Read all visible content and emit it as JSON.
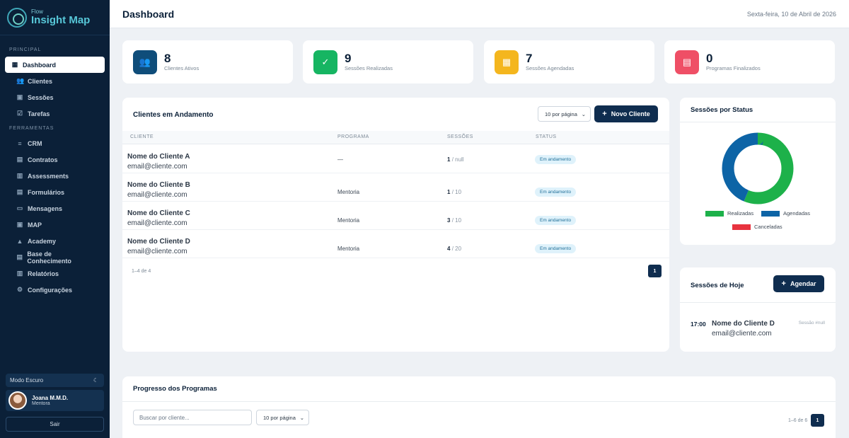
{
  "brand": {
    "small": "Flow",
    "name": "Insight Map"
  },
  "sidebar": {
    "section_principal": "PRINCIPAL",
    "section_ferramentas": "FERRAMENTAS",
    "principal": [
      {
        "label": "Dashboard",
        "icon": "grid-icon"
      },
      {
        "label": "Clientes",
        "icon": "users-icon"
      },
      {
        "label": "Sessões",
        "icon": "calendar-icon"
      },
      {
        "label": "Tarefas",
        "icon": "checkbox-icon"
      }
    ],
    "ferramentas": [
      {
        "label": "CRM",
        "icon": "list-icon"
      },
      {
        "label": "Contratos",
        "icon": "document-icon"
      },
      {
        "label": "Assessments",
        "icon": "chart-icon"
      },
      {
        "label": "Formulários",
        "icon": "form-icon"
      },
      {
        "label": "Mensagens",
        "icon": "message-icon"
      },
      {
        "label": "MAP",
        "icon": "map-icon"
      },
      {
        "label": "Academy",
        "icon": "graduation-icon"
      },
      {
        "label": "Base de Conhecimento",
        "icon": "book-icon"
      },
      {
        "label": "Relatórios",
        "icon": "report-icon"
      },
      {
        "label": "Configurações",
        "icon": "gear-icon"
      }
    ],
    "dark_mode": "Modo Escuro",
    "user": {
      "name": "Joana M.M.D.",
      "role": "Mentora"
    },
    "logout": "Sair"
  },
  "header": {
    "title": "Dashboard",
    "date": "Sexta-feira, 10 de Abril de 2026"
  },
  "stats": [
    {
      "value": "8",
      "label": "Clientes Ativos",
      "color": "#0f4d7a"
    },
    {
      "value": "9",
      "label": "Sessões Realizadas",
      "color": "#16b562"
    },
    {
      "value": "7",
      "label": "Sessões Agendadas",
      "color": "#f4b61e"
    },
    {
      "value": "0",
      "label": "Programas Finalizados",
      "color": "#ef4f66"
    }
  ],
  "clients": {
    "title": "Clientes em Andamento",
    "per_page": "10 por página",
    "new_button": "Novo Cliente",
    "columns": [
      "CLIENTE",
      "PROGRAMA",
      "SESSÕES",
      "STATUS"
    ],
    "rows": [
      {
        "name": "Nome do Cliente A",
        "email": "email@cliente.com",
        "program": "—",
        "done": "1",
        "total": "/ null",
        "status": "Em andamento"
      },
      {
        "name": "Nome do Cliente B",
        "email": "email@cliente.com",
        "program": "Mentoria",
        "done": "1",
        "total": "/ 10",
        "status": "Em andamento"
      },
      {
        "name": "Nome do Cliente C",
        "email": "email@cliente.com",
        "program": "Mentoria",
        "done": "3",
        "total": "/ 10",
        "status": "Em andamento"
      },
      {
        "name": "Nome do Cliente D",
        "email": "email@cliente.com",
        "program": "Mentoria",
        "done": "4",
        "total": "/ 20",
        "status": "Em andamento"
      }
    ],
    "pagination_info": "1–4 de 4",
    "page": "1"
  },
  "status_chart": {
    "title": "Sessões por Status",
    "chart_data": {
      "type": "pie",
      "categories": [
        "Realizadas",
        "Agendadas",
        "Canceladas"
      ],
      "values": [
        9,
        7,
        0
      ],
      "colors": [
        "#1db14a",
        "#0d64a6",
        "#e8333f"
      ],
      "legend": "bottom"
    }
  },
  "today": {
    "title": "Sessões de Hoje",
    "button": "Agendar",
    "items": [
      {
        "time": "17:00",
        "name": "Nome do Cliente D",
        "email": "email@cliente.com",
        "tag": "Sessão #null"
      }
    ]
  },
  "progress": {
    "title": "Progresso dos Programas",
    "search_placeholder": "Buscar por cliente...",
    "per_page": "10 por página",
    "pagination_info": "1–6 de 6",
    "page": "1"
  }
}
